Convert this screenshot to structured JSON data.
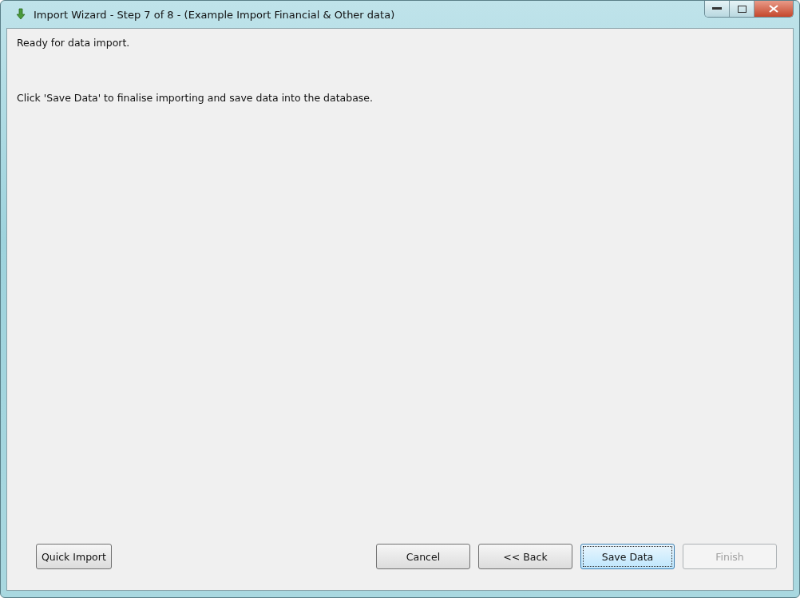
{
  "window": {
    "title": "Import Wizard - Step 7 of 8 - (Example Import Financial & Other data)"
  },
  "messages": [
    "Ready for data import.",
    "Click 'Save Data' to finalise importing and save data into the database."
  ],
  "left_buttons": [
    {
      "label": "Quick Import",
      "disabled": false,
      "focused": false
    }
  ],
  "right_buttons": [
    {
      "label": "Cancel",
      "disabled": false,
      "focused": false
    },
    {
      "label": "<< Back",
      "disabled": false,
      "focused": false
    },
    {
      "label": "Save Data",
      "disabled": false,
      "focused": true
    },
    {
      "label": "Finish",
      "disabled": true,
      "focused": false
    }
  ]
}
